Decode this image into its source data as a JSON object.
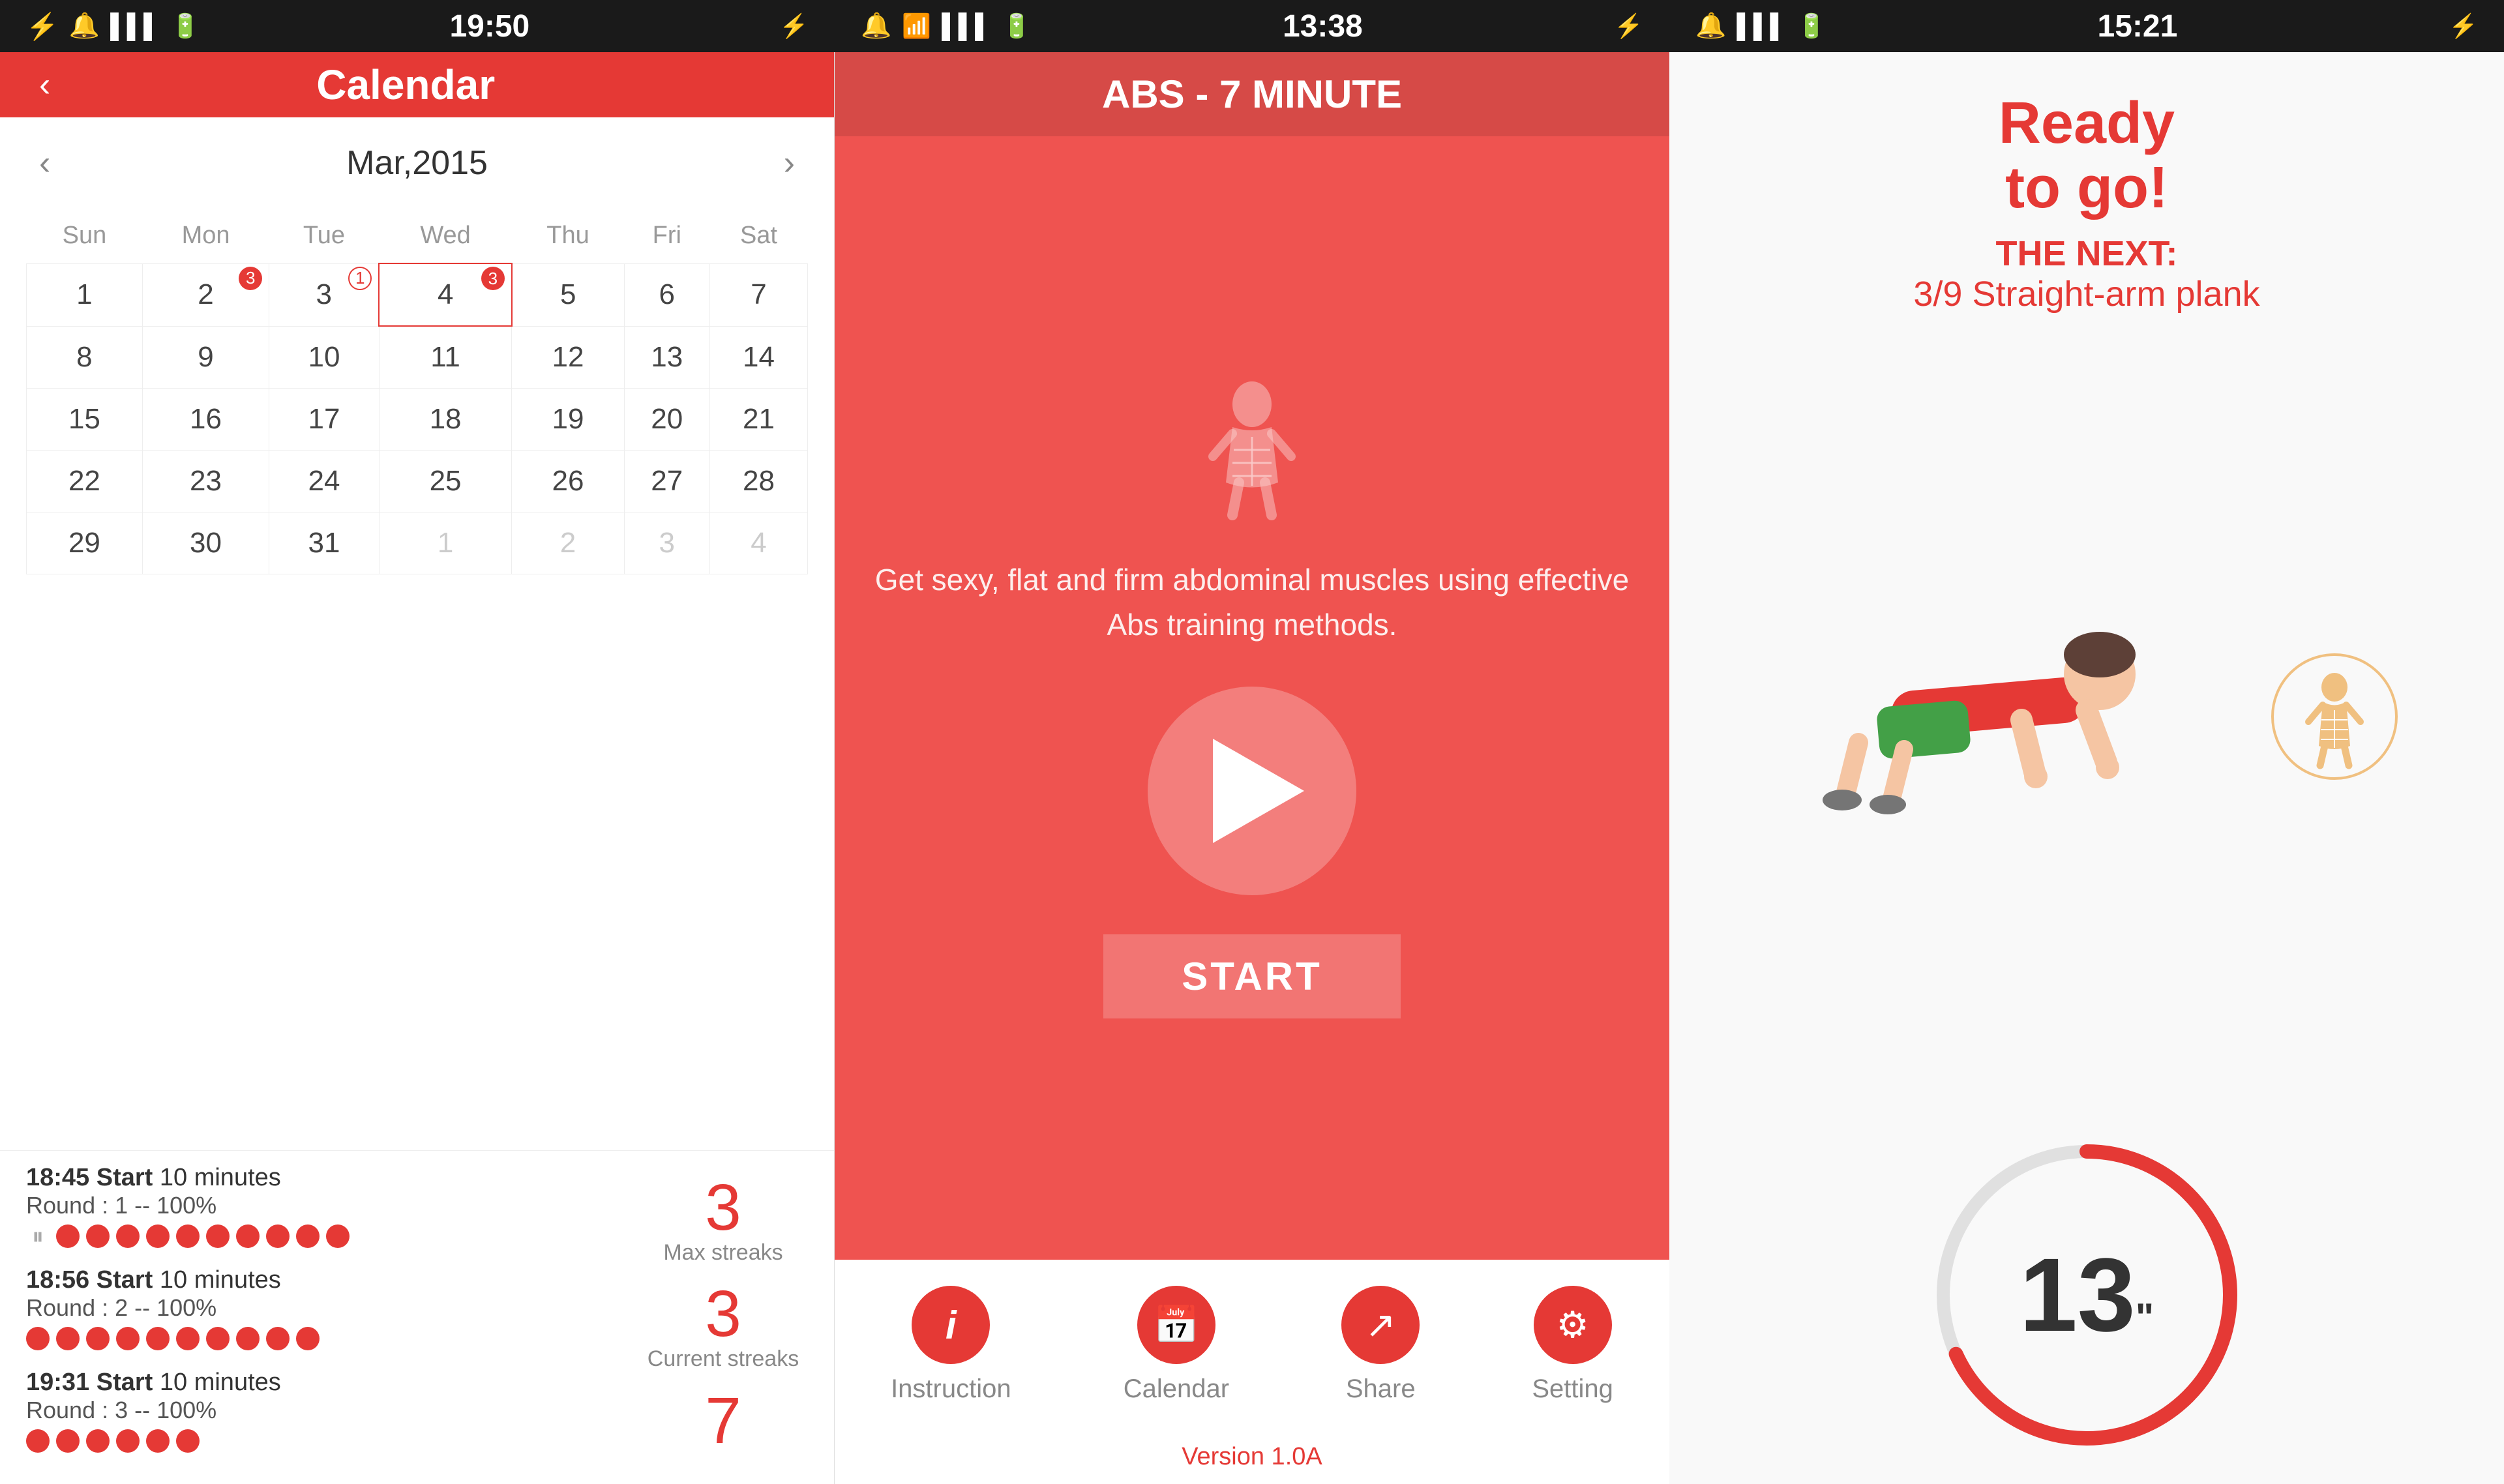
{
  "statusBars": [
    {
      "left_icons": "⚡ 🔔 📶 🔋",
      "time": "19:50",
      "right_icon": "⚡"
    },
    {
      "left_icons": "🔔 📶 🔋",
      "time": "13:38",
      "right_icon": "⚡"
    },
    {
      "left_icons": "🔔 📶 🔋",
      "time": "15:21",
      "right_icon": "⚡"
    }
  ],
  "calendar": {
    "back_label": "‹",
    "title": "Calendar",
    "month": "Mar,2015",
    "prev_label": "‹",
    "next_label": "›",
    "day_headers": [
      "Sun",
      "Mon",
      "Tue",
      "Wed",
      "Thu",
      "Fri",
      "Sat"
    ],
    "weeks": [
      [
        {
          "day": "1",
          "badge": null,
          "today": false,
          "other": false
        },
        {
          "day": "2",
          "badge": "3",
          "badgeType": "filled",
          "today": false,
          "other": false
        },
        {
          "day": "3",
          "badge": "1",
          "badgeType": "outline",
          "today": false,
          "other": false
        },
        {
          "day": "4",
          "badge": "3",
          "badgeType": "filled",
          "today": true,
          "other": false
        },
        {
          "day": "5",
          "badge": null,
          "today": false,
          "other": false
        },
        {
          "day": "6",
          "badge": null,
          "today": false,
          "other": false
        },
        {
          "day": "7",
          "badge": null,
          "today": false,
          "other": false
        }
      ],
      [
        {
          "day": "8",
          "badge": null,
          "today": false,
          "other": false
        },
        {
          "day": "9",
          "badge": null,
          "today": false,
          "other": false
        },
        {
          "day": "10",
          "badge": null,
          "today": false,
          "other": false
        },
        {
          "day": "11",
          "badge": null,
          "today": false,
          "other": false
        },
        {
          "day": "12",
          "badge": null,
          "today": false,
          "other": false
        },
        {
          "day": "13",
          "badge": null,
          "today": false,
          "other": false
        },
        {
          "day": "14",
          "badge": null,
          "today": false,
          "other": false
        }
      ],
      [
        {
          "day": "15",
          "badge": null,
          "today": false,
          "other": false
        },
        {
          "day": "16",
          "badge": null,
          "today": false,
          "other": false
        },
        {
          "day": "17",
          "badge": null,
          "today": false,
          "other": false
        },
        {
          "day": "18",
          "badge": null,
          "today": false,
          "other": false
        },
        {
          "day": "19",
          "badge": null,
          "today": false,
          "other": false
        },
        {
          "day": "20",
          "badge": null,
          "today": false,
          "other": false
        },
        {
          "day": "21",
          "badge": null,
          "today": false,
          "other": false
        }
      ],
      [
        {
          "day": "22",
          "badge": null,
          "today": false,
          "other": false
        },
        {
          "day": "23",
          "badge": null,
          "today": false,
          "other": false
        },
        {
          "day": "24",
          "badge": null,
          "today": false,
          "other": false
        },
        {
          "day": "25",
          "badge": null,
          "today": false,
          "other": false
        },
        {
          "day": "26",
          "badge": null,
          "today": false,
          "other": false
        },
        {
          "day": "27",
          "badge": null,
          "today": false,
          "other": false
        },
        {
          "day": "28",
          "badge": null,
          "today": false,
          "other": false
        }
      ],
      [
        {
          "day": "29",
          "badge": null,
          "today": false,
          "other": false
        },
        {
          "day": "30",
          "badge": null,
          "today": false,
          "other": false
        },
        {
          "day": "31",
          "badge": null,
          "today": false,
          "other": false
        },
        {
          "day": "1",
          "badge": null,
          "today": false,
          "other": true
        },
        {
          "day": "2",
          "badge": null,
          "today": false,
          "other": true
        },
        {
          "day": "3",
          "badge": null,
          "today": false,
          "other": true
        },
        {
          "day": "4",
          "badge": null,
          "today": false,
          "other": true
        }
      ]
    ]
  },
  "logs": [
    {
      "title_time": "18:45",
      "title_action": "Start",
      "title_duration": "10 minutes",
      "sub": "Round : 1 -- 100%",
      "dots": 10,
      "has_pause": true
    },
    {
      "title_time": "18:56",
      "title_action": "Start",
      "title_duration": "10 minutes",
      "sub": "Round : 2 -- 100%",
      "dots": 10,
      "has_pause": false
    },
    {
      "title_time": "19:31",
      "title_action": "Start",
      "title_duration": "10 minutes",
      "sub": "Round : 3 -- 100%",
      "dots": 6,
      "has_pause": false
    }
  ],
  "stats": {
    "max_streaks_value": "3",
    "max_streaks_label": "Max streaks",
    "current_streaks_value": "3",
    "current_streaks_label": "Current streaks",
    "total_value": "7"
  },
  "abs": {
    "title": "ABS - 7 MINUTE",
    "description": "Get sexy, flat and firm abdominal muscles\nusing effective Abs training methods.",
    "start_label": "START"
  },
  "footer_nav": {
    "items": [
      {
        "icon": "ℹ",
        "label": "Instruction"
      },
      {
        "icon": "📅",
        "label": "Calendar"
      },
      {
        "icon": "↗",
        "label": "Share"
      },
      {
        "icon": "⚙",
        "label": "Setting"
      }
    ]
  },
  "version": "Version 1.0A",
  "timer": {
    "ready_line1": "Ready",
    "ready_line2": "to go!",
    "next_label": "THE NEXT:",
    "next_exercise": "3/9 Straight-arm plank",
    "seconds": "13",
    "quote": "\""
  }
}
